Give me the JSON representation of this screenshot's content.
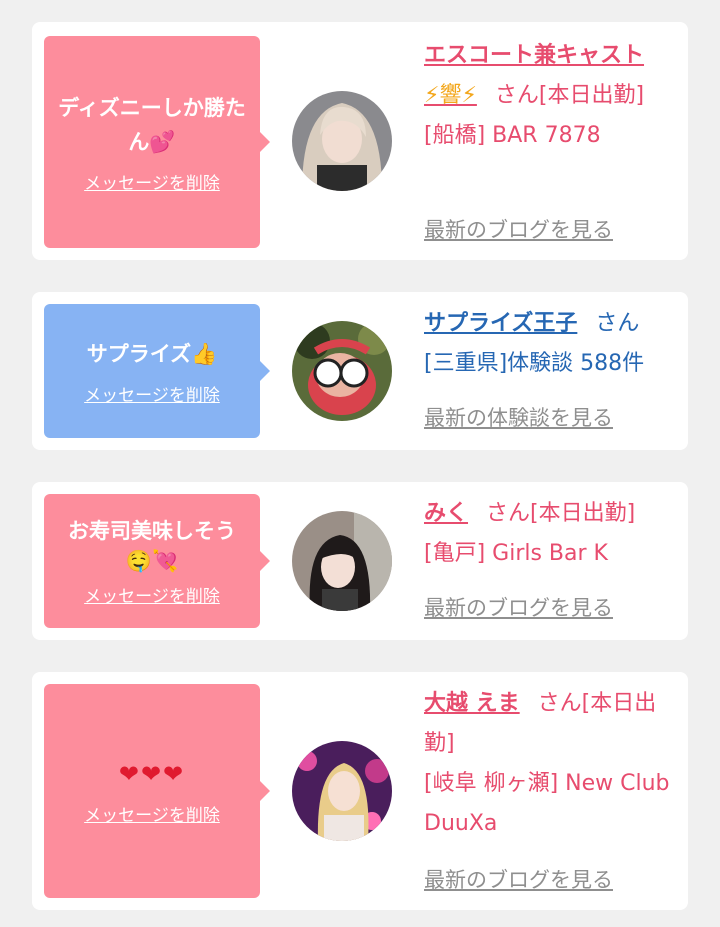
{
  "colors": {
    "pink_bubble": "#fd8d9c",
    "blue_bubble": "#87b3f3",
    "name_pink": "#e74c6e",
    "name_blue": "#2667b3",
    "link_gray": "#8f8f8f"
  },
  "delete_label": "メッセージを削除",
  "items": [
    {
      "message": "ディズニーしか勝たん",
      "message_emoji": "💕",
      "name": "エスコート兼キャスト",
      "name_emoji": "⚡響⚡",
      "suffix": "さん[本日出勤]",
      "line2": "[船橋] BAR 7878",
      "more": "最新のブログを見る",
      "avatar_icon": "avatar-photo"
    },
    {
      "message": "サプライズ",
      "message_emoji": "👍",
      "name": "サプライズ王子",
      "suffix": "さん",
      "line2": "[三重県]体験談 588件",
      "more": "最新の体験談を見る",
      "avatar_icon": "avatar-photo"
    },
    {
      "message": "お寿司美味しそう",
      "message_emoji": "🤤💘",
      "name": "みく",
      "suffix": "さん[本日出勤]",
      "line2": "[亀戸] Girls Bar K",
      "more": "最新のブログを見る",
      "avatar_icon": "avatar-photo"
    },
    {
      "message": "❤❤❤",
      "name": "大越 えま",
      "suffix": "さん[本日出勤]",
      "line2": "[岐阜 柳ヶ瀬] New Club DuuXa",
      "more": "最新のブログを見る",
      "avatar_icon": "avatar-photo"
    }
  ]
}
